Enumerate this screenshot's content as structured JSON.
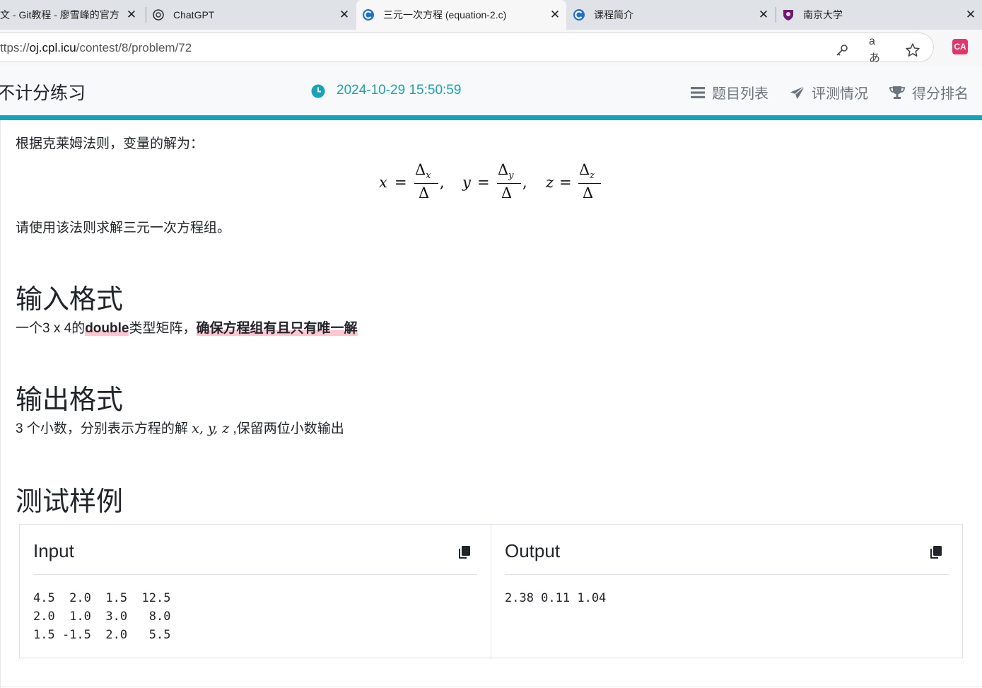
{
  "browser": {
    "tabs": [
      {
        "title": "文 - Git教程 - 廖雪峰的官方",
        "icon": "site-favicon-icon"
      },
      {
        "title": "ChatGPT",
        "icon": "chatgpt-icon"
      },
      {
        "title": "三元一次方程 (equation-2.c)",
        "icon": "cpl-oj-icon",
        "active": true
      },
      {
        "title": "课程简介",
        "icon": "cpl-oj-icon"
      },
      {
        "title": "南京大学",
        "icon": "nju-crest-icon"
      }
    ],
    "close_glyph": "✕",
    "url_scheme": "ttps://",
    "url_host": "oj.cpl.icu",
    "url_path": "/contest/8/problem/72",
    "extension_label": "CA"
  },
  "navbar": {
    "brand": "不计分练习",
    "time": "2024-10-29 15:50:59",
    "items": [
      {
        "label": "题目列表",
        "icon": "list-icon"
      },
      {
        "label": "评测情况",
        "icon": "paper-plane-icon"
      },
      {
        "label": "得分排名",
        "icon": "trophy-icon"
      }
    ]
  },
  "content": {
    "cramer_intro": "根据克莱姆法则，变量的解为：",
    "formula": {
      "terms": [
        {
          "var": "x",
          "eq": "=",
          "num": "Δ",
          "sub": "x",
          "den": "Δ",
          "comma": ","
        },
        {
          "var": "y",
          "eq": "=",
          "num": "Δ",
          "sub": "y",
          "den": "Δ",
          "comma": ","
        },
        {
          "var": "z",
          "eq": "=",
          "num": "Δ",
          "sub": "z",
          "den": "Δ",
          "comma": ""
        }
      ]
    },
    "instruction": "请使用该法则求解三元一次方程组。",
    "input_heading": "输入格式",
    "input_desc": {
      "prefix": "一个3 x 4的",
      "bold1": "double",
      "middle": "类型矩阵，",
      "bold2": "确保方程组有且只有唯一解"
    },
    "output_heading": "输出格式",
    "output_desc": {
      "prefix": "3 个小数，分别表示方程的解 ",
      "math": "x, y, z",
      "suffix": " ,保留两位小数输出"
    },
    "sample_heading": "测试样例",
    "sample_input_title": "Input",
    "sample_input": "4.5  2.0  1.5  12.5\n2.0  1.0  3.0   8.0\n1.5 -1.5  2.0   5.5",
    "sample_output_title": "Output",
    "sample_output": "2.38 0.11 1.04"
  },
  "colors": {
    "accent": "#17a2b8",
    "highlight": "#ffc6d2",
    "navbar_bg": "#f8f9fa",
    "tabstrip_bg": "#dfe3e8"
  }
}
